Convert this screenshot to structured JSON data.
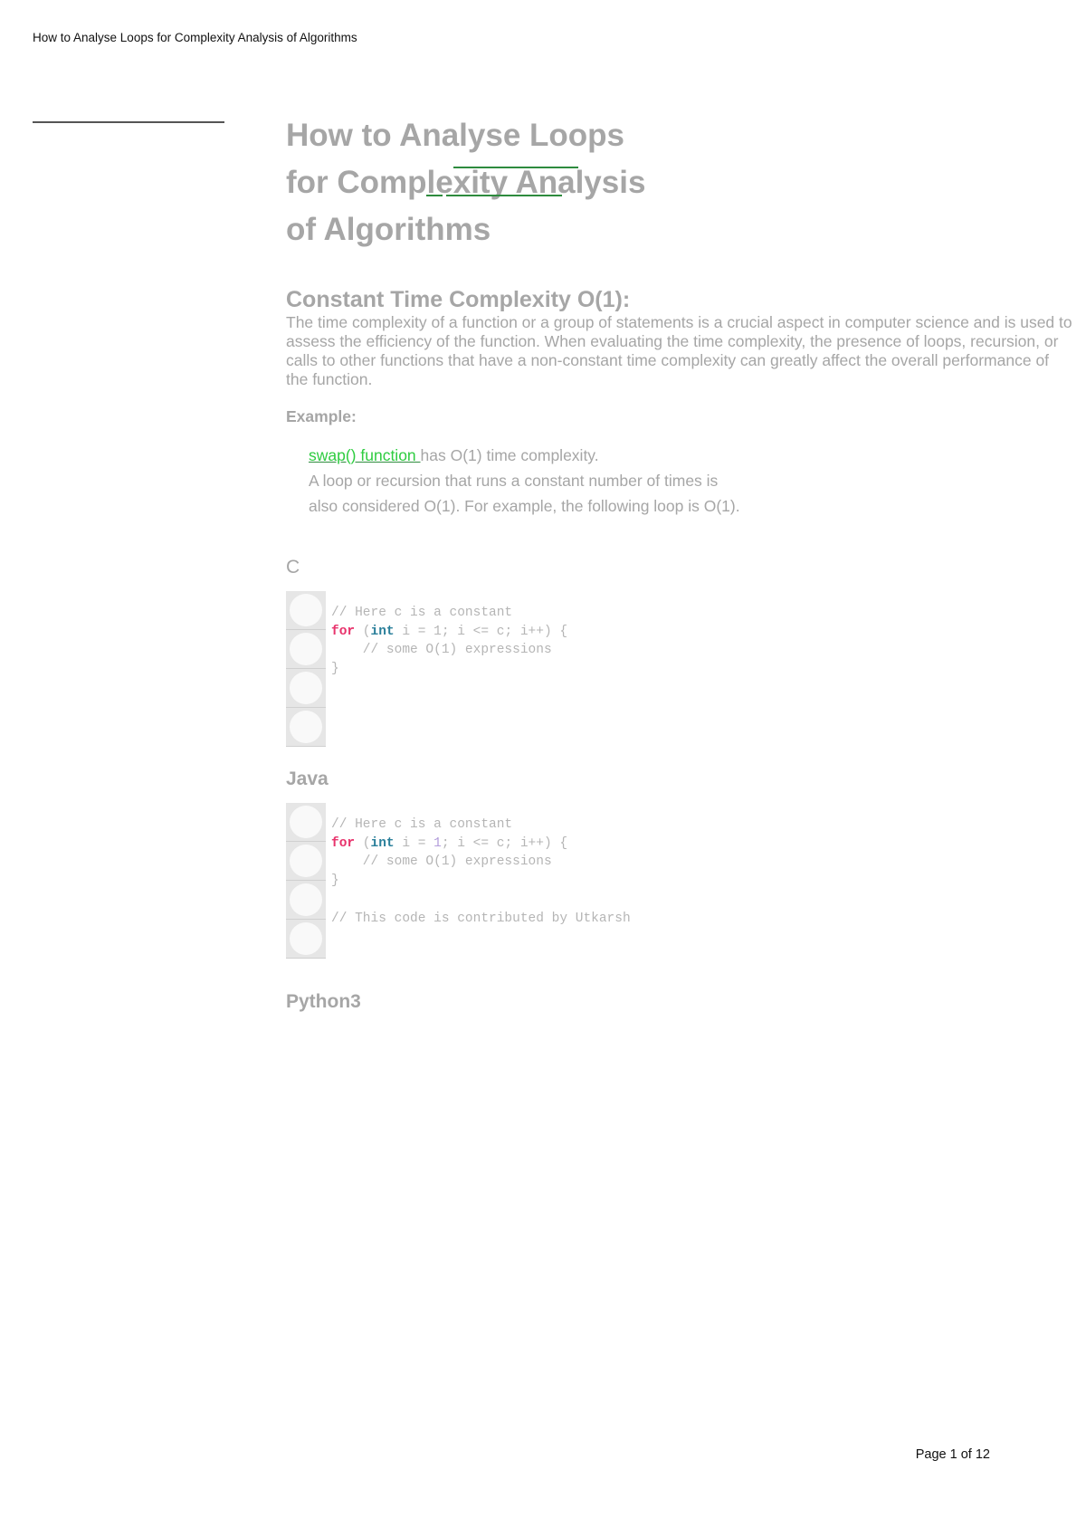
{
  "header": {
    "running_title": "How to Analyse Loops for Complexity Analysis of Algorithms"
  },
  "article": {
    "title_lines": [
      "How to Analyse Loops",
      "for Complexity Analysis",
      "of Algorithms"
    ],
    "section": {
      "heading": "Constant Time Complexity O(1):",
      "paragraph": "The time complexity of a function or a group of statements is a crucial aspect in computer science and is used to assess the efficiency of the function. When evaluating the time complexity, the presence of loops, recursion, or calls to other functions that have a non-constant time complexity can greatly affect the overall performance of the function.",
      "example_label": "Example:",
      "example_link": "swap() function ",
      "example_line1_rest": "has O(1) time complexity.",
      "example_line2": "A loop or recursion that runs a constant number of times is also considered O(1). For example, the following loop is O(1)."
    },
    "code_samples": [
      {
        "language": "C",
        "lines": {
          "l1": "// Here c is a constant",
          "l2_kw": "for",
          "l2_a": " (",
          "l2_type": "int",
          "l2_b": " i = 1; i <= c; i++) {",
          "l3": "    // some O(1) expressions",
          "l4": "}"
        }
      },
      {
        "language": "Java",
        "lines": {
          "l1": "// Here c is a constant",
          "l2_kw": "for",
          "l2_a": " (",
          "l2_type": "int",
          "l2_b1": " i = ",
          "l2_num": "1",
          "l2_b2": "; i <= c; i++) {",
          "l3": "    // some O(1) expressions",
          "l4": "}",
          "l5": "",
          "l6": "// This code is contributed by Utkarsh"
        }
      },
      {
        "language": "Python3"
      }
    ]
  },
  "footer": {
    "page_label": "Page 1 of 12"
  },
  "colors": {
    "muted_text": "#a6a6a6",
    "link": "#2ecc40",
    "keyword": "#e8336c",
    "type": "#2a7f9a"
  }
}
